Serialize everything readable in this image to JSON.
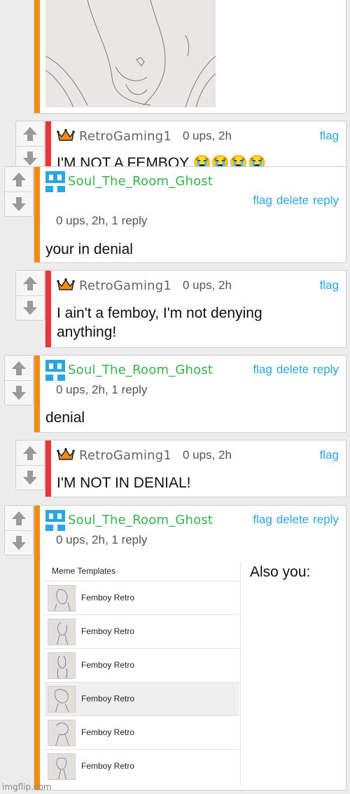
{
  "comments": [
    {
      "username": "RetroGaming1",
      "meta": "0 ups, 2h",
      "links": [
        "flag"
      ],
      "text": "I'M NOT A FEMBOY 😭😭😭😭"
    },
    {
      "username": "Soul_The_Room_Ghost",
      "meta": "0 ups, 2h, 1 reply",
      "links": [
        "flag",
        "delete",
        "reply"
      ],
      "text": "your in denial"
    },
    {
      "username": "RetroGaming1",
      "meta": "0 ups, 2h",
      "links": [
        "flag"
      ],
      "text": "I ain't a femboy, I'm not denying anything!"
    },
    {
      "username": "Soul_The_Room_Ghost",
      "meta": "0 ups, 2h, 1 reply",
      "links": [
        "flag",
        "delete",
        "reply"
      ],
      "text": "denial"
    },
    {
      "username": "RetroGaming1",
      "meta": "0 ups, 2h",
      "links": [
        "flag"
      ],
      "text": "I'M NOT IN DENIAL!"
    },
    {
      "username": "Soul_The_Room_Ghost",
      "meta": "0 ups, 2h, 1 reply",
      "links": [
        "flag",
        "delete",
        "reply"
      ],
      "text": ""
    }
  ],
  "meme_panel": {
    "title": "Meme Templates",
    "items": [
      "Femboy Retro",
      "Femboy Retro",
      "Femboy Retro",
      "Femboy Retro",
      "Femboy Retro",
      "Femboy Retro"
    ],
    "caption": "Also you:"
  },
  "watermark": "imgflip.com",
  "colors": {
    "op_bar": "#f28b13",
    "reply_bar": "#e8343a",
    "link": "#2aa6e0",
    "soul_name": "#37b24d",
    "retro_name": "#666666"
  }
}
